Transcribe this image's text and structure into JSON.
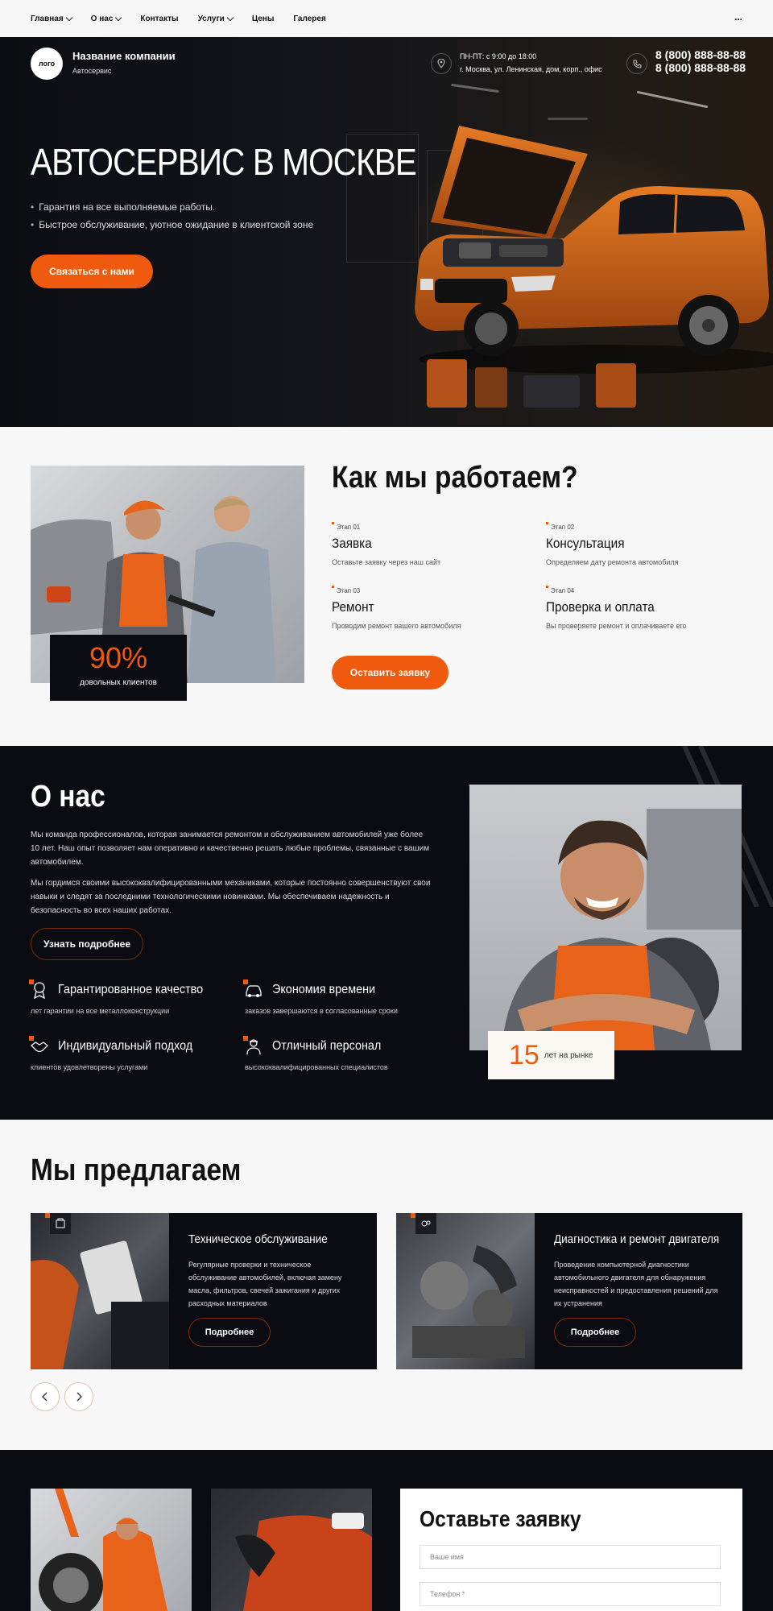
{
  "nav": {
    "items": [
      {
        "label": "Главная",
        "dropdown": true
      },
      {
        "label": "О нас",
        "dropdown": true
      },
      {
        "label": "Контакты",
        "dropdown": false
      },
      {
        "label": "Услуги",
        "dropdown": true
      },
      {
        "label": "Цены",
        "dropdown": false
      },
      {
        "label": "Галерея",
        "dropdown": false
      }
    ],
    "more": "..."
  },
  "header": {
    "logo": "лого",
    "company_name": "Название компании",
    "company_sub": "Автосервис",
    "hours_line1": "ПН-ПТ: с 9:00 до  18:00",
    "hours_line2": "г. Москва, ул. Ленинская, дом, корп., офис",
    "phone1": "8 (800) 888-88-88",
    "phone2": "8 (800) 888-88-88"
  },
  "hero": {
    "title": "АВТОСЕРВИС В МОСКВЕ",
    "bullets": [
      "Гарантия на все выполняемые работы.",
      "Быстрое обслуживание, уютное ожидание в клиентской зоне"
    ],
    "cta": "Связаться с нами"
  },
  "how": {
    "title": "Как мы работаем?",
    "percent": "90%",
    "percent_label": "довольных клиентов",
    "steps": [
      {
        "num": "Этап 01",
        "name": "Заявка",
        "desc": "Оставьте заявку через наш сайт"
      },
      {
        "num": "Этап 02",
        "name": "Консультация",
        "desc": "Определяем дату ремонта автомобиля"
      },
      {
        "num": "Этап 03",
        "name": "Ремонт",
        "desc": "Проводим ремонт вашего автомобиля"
      },
      {
        "num": "Этап 04",
        "name": "Проверка и оплата",
        "desc": "Вы проверяете ремонт и оплачиваете его"
      }
    ],
    "cta": "Оставить заявку"
  },
  "about": {
    "title": "О нас",
    "p1": "Мы команда профессионалов, которая занимается ремонтом и обслуживанием автомобилей уже более 10 лет. Наш опыт позволяет нам оперативно и качественно решать любые проблемы, связанные с вашим автомобилем.",
    "p2": "Мы гордимся своими высококвалифицированными механиками, которые постоянно совершенствуют свои навыки и следят за последними технологическими новинками. Мы обеспечиваем надежность и безопасность во всех наших работах.",
    "button": "Узнать подробнее",
    "features": [
      {
        "name": "Гарантированное качество",
        "desc": "лет гарантии на все металлоконструкции",
        "icon": "medal-icon"
      },
      {
        "name": "Экономия времени",
        "desc": "заказов завершаются в согласованные сроки",
        "icon": "car-icon"
      },
      {
        "name": "Индивидуальный подход",
        "desc": "клиентов удовлетворены  услугами",
        "icon": "handshake-icon"
      },
      {
        "name": "Отличный персонал",
        "desc": "высококвалифицированных специалистов",
        "icon": "worker-icon"
      }
    ],
    "years": "15",
    "years_label": "лет на рынке"
  },
  "offers": {
    "title": "Мы предлагаем",
    "cards": [
      {
        "title": "Техническое обслуживание",
        "desc": "Регулярные проверки и техническое обслуживание автомобилей, включая замену масла, фильтров, свечей зажигания и других расходных материалов",
        "button": "Подробнее",
        "icon": "service-icon"
      },
      {
        "title": "Диагностика и ремонт двигателя",
        "desc": "Проведение компьютерной диагностики автомобильного двигателя для обнаружения неисправностей и предоставления решений для их устранения",
        "button": "Подробнее",
        "icon": "engine-icon"
      }
    ]
  },
  "form": {
    "title": "Оставьте заявку",
    "name_placeholder": "Ваше имя",
    "phone_placeholder": "Телефон *"
  },
  "colors": {
    "accent": "#f05a0f",
    "dark": "#0b0c12",
    "light": "#f7f7f7"
  }
}
